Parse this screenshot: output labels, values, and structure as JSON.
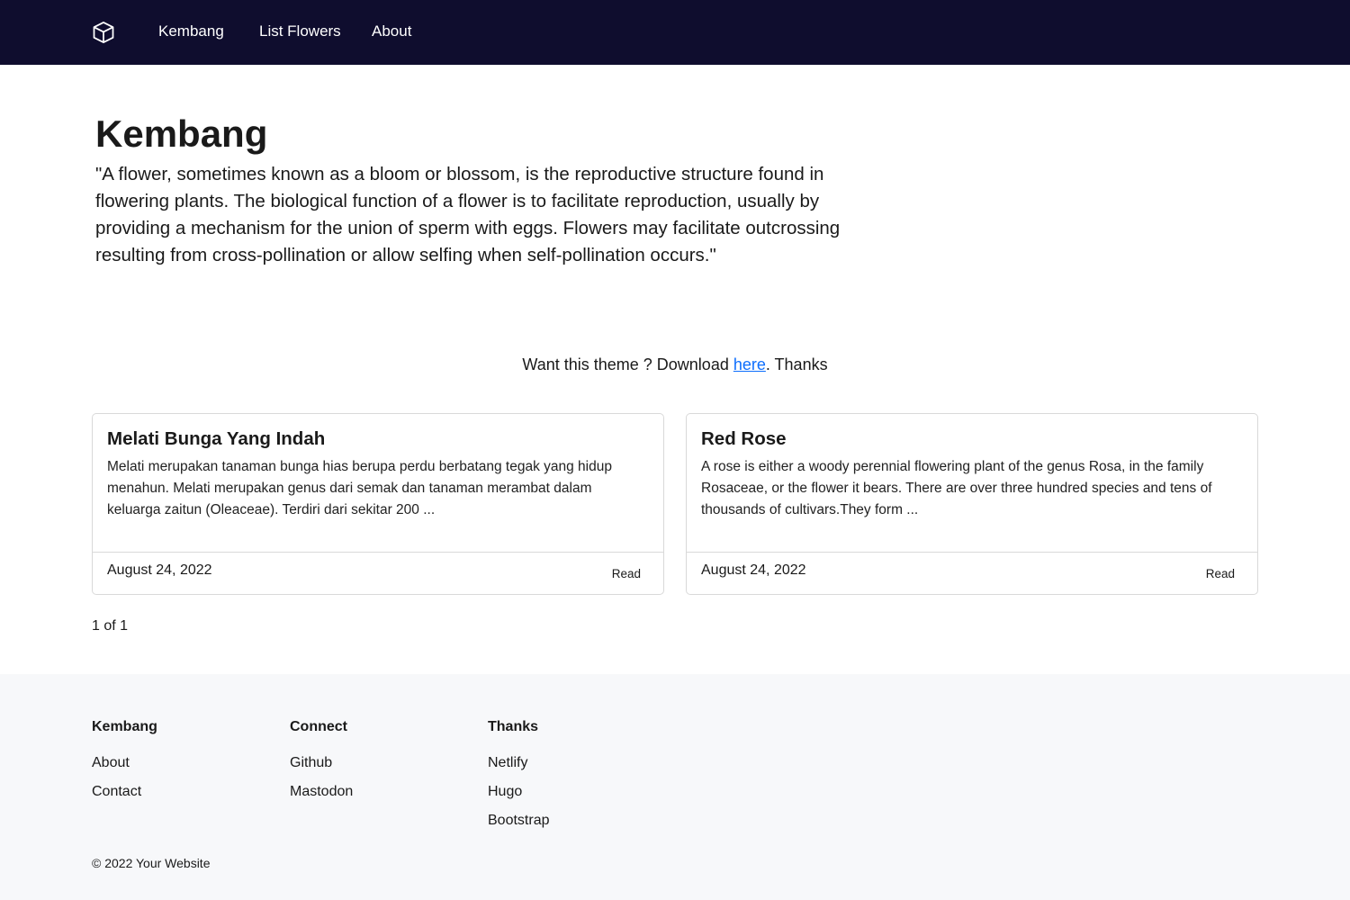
{
  "nav": {
    "logo_icon": "box-icon",
    "links": [
      "Kembang",
      "List Flowers",
      "About"
    ]
  },
  "hero": {
    "title": "Kembang",
    "quote": "\"A flower, sometimes known as a bloom or blossom, is the reproductive structure found in flowering plants. The biological function of a flower is to facilitate reproduction, usually by providing a mechanism for the union of sperm with eggs. Flowers may facilitate outcrossing resulting from cross-pollination or allow selfing when self-pollination occurs.\""
  },
  "download": {
    "prefix": "Want this theme ? Download ",
    "link_text": "here",
    "suffix": ". Thanks"
  },
  "posts": [
    {
      "title": "Melati Bunga Yang Indah",
      "excerpt": "Melati merupakan tanaman bunga hias berupa perdu berbatang tegak yang hidup menahun. Melati merupakan genus dari semak dan tanaman merambat dalam keluarga zaitun (Oleaceae). Terdiri dari sekitar 200 ...",
      "date": "August 24, 2022",
      "read_label": "Read"
    },
    {
      "title": "Red Rose",
      "excerpt": "A rose is either a woody perennial flowering plant of the genus Rosa, in the family Rosaceae, or the flower it bears. There are over three hundred species and tens of thousands of cultivars.They form ...",
      "date": "August 24, 2022",
      "read_label": "Read"
    }
  ],
  "pagination": "1 of 1",
  "footer": {
    "columns": [
      {
        "heading": "Kembang",
        "links": [
          "About",
          "Contact"
        ]
      },
      {
        "heading": "Connect",
        "links": [
          "Github",
          "Mastodon"
        ]
      },
      {
        "heading": "Thanks",
        "links": [
          "Netlify",
          "Hugo",
          "Bootstrap"
        ]
      }
    ],
    "copyright": "© 2022 Your Website"
  },
  "colors": {
    "navbar_bg": "#0f0d2e",
    "link_blue": "#0d6efd",
    "footer_bg": "#f7f8fa"
  }
}
